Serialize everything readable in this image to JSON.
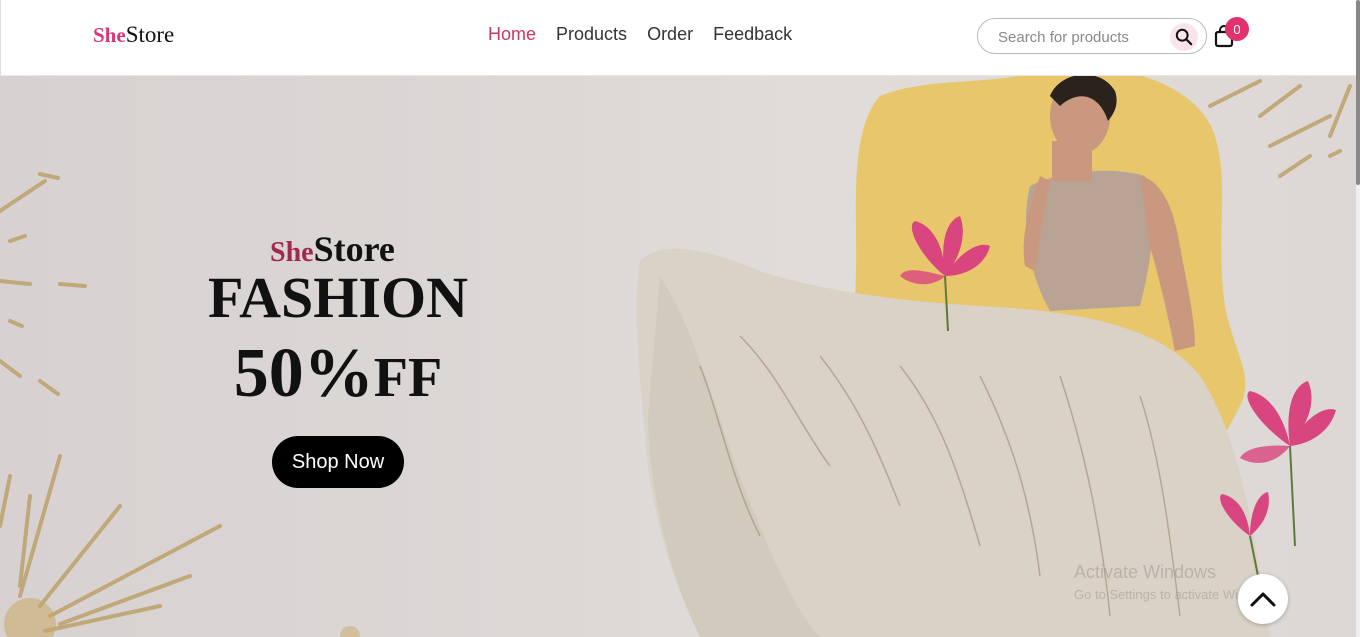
{
  "header": {
    "logo_she": "She",
    "logo_store": "Store",
    "nav": [
      "Home",
      "Products",
      "Order",
      "Feedback"
    ],
    "active_nav": "Home",
    "search_placeholder": "Search for products",
    "cart_count": "0"
  },
  "hero": {
    "brand_she": "She",
    "brand_store": "Store",
    "title": "FASHION",
    "offer_pct": "50%",
    "offer_ff": "FF",
    "cta_label": "Shop Now"
  },
  "watermark": {
    "line1": "Activate Windows",
    "line2": "Go to Settings to activate Windows."
  },
  "colors": {
    "brand_pink": "#d9387a",
    "nav_active": "#c8385f",
    "badge": "#e0336e",
    "blob_yellow": "#e8c66c",
    "lotus": "#d9457f"
  },
  "icons": [
    "search-icon",
    "bag-icon",
    "chevron-up-icon"
  ]
}
